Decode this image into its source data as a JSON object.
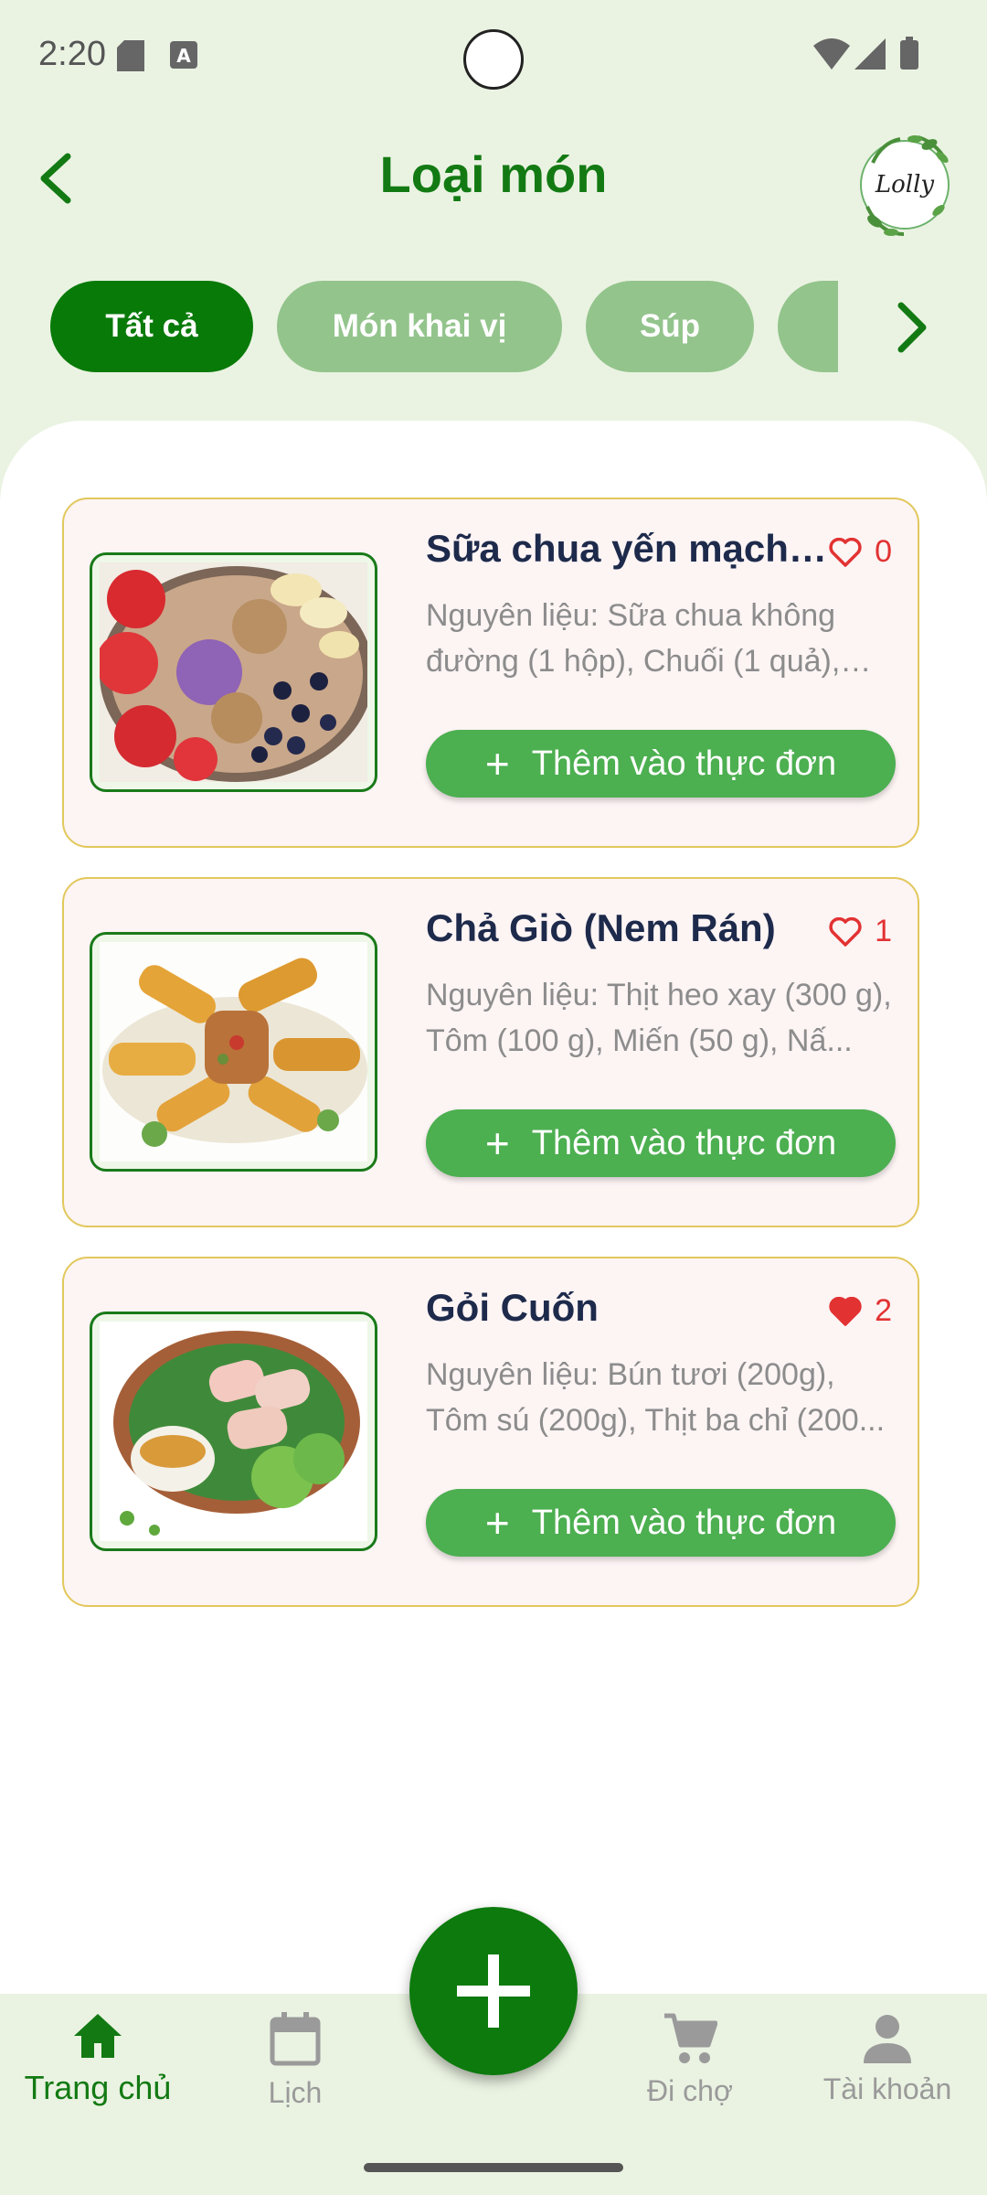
{
  "status_bar": {
    "time": "2:20"
  },
  "header": {
    "title": "Loại món",
    "logo_text": "Lolly"
  },
  "categories": [
    {
      "label": "Tất cả",
      "active": true
    },
    {
      "label": "Món khai vị",
      "active": false
    },
    {
      "label": "Súp",
      "active": false
    },
    {
      "label": "",
      "active": false
    }
  ],
  "dishes": [
    {
      "title": "Sữa chua yến mạch t...",
      "likes": "0",
      "liked": false,
      "description": "Nguyên liệu: Sữa chua không đường (1 hộp), Chuối (1 quả), D...",
      "add_label": "Thêm vào thực đơn"
    },
    {
      "title": "Chả Giò (Nem Rán)",
      "likes": "1",
      "liked": false,
      "description": "Nguyên liệu: Thịt heo xay (300 g), Tôm (100 g), Miến (50 g), Nấ...",
      "add_label": "Thêm vào thực đơn"
    },
    {
      "title": "Gỏi Cuốn",
      "likes": "2",
      "liked": true,
      "description": "Nguyên liệu: Bún tươi (200g), Tôm sú (200g), Thịt ba chỉ (200...",
      "add_label": "Thêm vào thực đơn"
    }
  ],
  "bottom_nav": {
    "home": "Trang chủ",
    "calendar": "Lịch",
    "market": "Đi chợ",
    "account": "Tài khoản"
  },
  "colors": {
    "primary": "#137a13",
    "accent_green": "#4caf50",
    "chip_inactive": "#93c48c",
    "like_red": "#e23232",
    "background": "#eaf3e2"
  }
}
